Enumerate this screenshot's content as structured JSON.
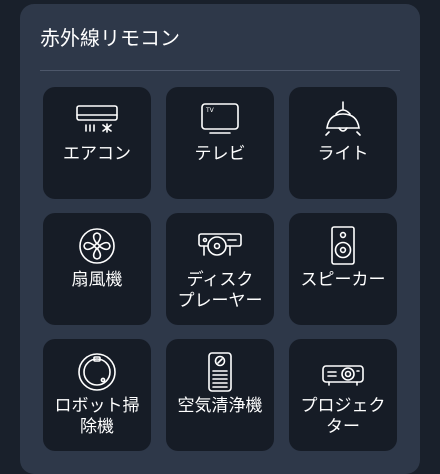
{
  "header": {
    "title": "赤外線リモコン"
  },
  "devices": [
    {
      "label": "エアコン",
      "icon": "air-conditioner-icon"
    },
    {
      "label": "テレビ",
      "icon": "tv-icon"
    },
    {
      "label": "ライト",
      "icon": "ceiling-light-icon"
    },
    {
      "label": "扇風機",
      "icon": "fan-icon"
    },
    {
      "label": "ディスク\nプレーヤー",
      "icon": "disc-player-icon"
    },
    {
      "label": "スピーカー",
      "icon": "speaker-icon"
    },
    {
      "label": "ロボット掃\n除機",
      "icon": "robot-vacuum-icon"
    },
    {
      "label": "空気清浄機",
      "icon": "air-purifier-icon"
    },
    {
      "label": "プロジェク\nター",
      "icon": "projector-icon"
    }
  ],
  "icon_text": {
    "tv_badge": "TV"
  },
  "colors": {
    "background": "#19202b",
    "panel": "#2e3849",
    "tile": "#161c26",
    "text": "#ffffff",
    "divider": "#4d576a"
  }
}
